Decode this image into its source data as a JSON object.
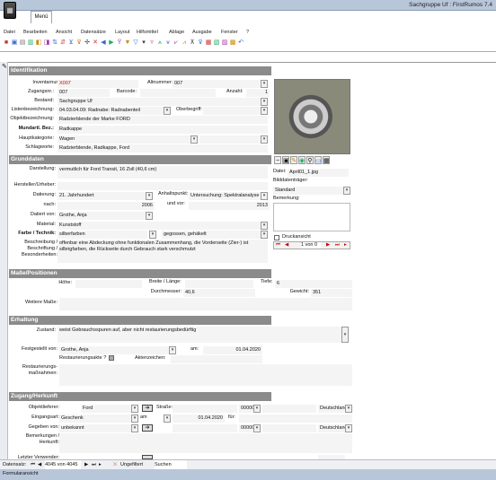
{
  "window": {
    "title": "Sachgruppe Uf : FirstRumos 7.4"
  },
  "menu_tab": "Menü",
  "menu": [
    "Datei",
    "Bearbeiten",
    "Ansicht",
    "Datensätze",
    "Layout",
    "Hilfsmittel",
    "Ablage",
    "Ausgabe",
    "Fenster",
    "?"
  ],
  "sections": {
    "identifikation": "Identifikation",
    "grunddaten": "Grunddaten",
    "masse": "Maße/Positionen",
    "erhaltung": "Erhaltung",
    "zugang": "Zugang/Herkunft"
  },
  "ident": {
    "inventarnummer_label": "Inventarnummer:",
    "inventarnummer": "X007",
    "altnummer_label": "Altnummer:",
    "altnummer": "007",
    "zugangsnr_label": "Zugangsnr.:",
    "zugangsnr": "007",
    "barcode_label": "Barcode:",
    "barcode": "",
    "anzahl_label": "Anzahl:",
    "anzahl": "1",
    "bestand_label": "Bestand:",
    "bestand": "Sachgruppe Uf",
    "listen_label": "Listenbezeichnung:",
    "listen": "04.03.04.09: Radnabe: Radnabenteil",
    "oberbegriff_label": "Oberbegriff:",
    "oberbegriff": "",
    "objekt_label": "Objektbezeichnung:",
    "objekt": "Radzierblende der Marke FORD",
    "mundart_label": "Mundartl. Bez.:",
    "mundart": "Radkappe",
    "haupt_label": "Hauptkategorie:",
    "haupt": "Wagen",
    "schlag_label": "Schlagworte:",
    "schlag": "Radzierblende, Radkappe, Ford"
  },
  "image_panel": {
    "datei_label": "Datei:",
    "datei": "April01_1.jpg",
    "bildtraeger_label": "Bilddatenträger:",
    "bildtraeger": "Standard",
    "bemerkung_label": "Bemerkung:",
    "bemerkung": "",
    "druck_label": "Druckansicht",
    "nav": "1 von 0"
  },
  "grund": {
    "darstellung_label": "Darstellung:",
    "darstellung": "vermutlich für Ford Transit, 16 Zoll (40,6 cm)",
    "hersteller_label": "Hersteller/Urheber:",
    "hersteller": "",
    "datierung_label": "Datierung:",
    "datierung": "21. Jahrhundert",
    "anhalt_label": "Anhaltspunkt:",
    "anhalt": "Untersuchung: Spektralanalyse",
    "nach_label": "nach:",
    "nach": "2006",
    "vor_label": "und vor:",
    "vor": "2013",
    "datiert_label": "Datiert von:",
    "datiert": "Grothe, Anja",
    "material_label": "Material:",
    "material": "Kunststoff",
    "farbe_label": "Farbe / Technik:",
    "farbe": "silberfarben",
    "technik": "gegossen, gehäkelt",
    "beschreibung_label": "Beschreibung / Beschriftung / Besonderheiten:",
    "beschreibung": "offenbar eine Abdeckung ohne funktionalen Zusammenhang, die Vorderseite (Zier-) ist silbrigfarben, die Rückseite durch Gebrauch stark verschmutzt"
  },
  "masse": {
    "hoehe_label": "Höhe:",
    "hoehe": "",
    "breite_label": "Breite / Länge:",
    "breite": "",
    "tiefe_label": "Tiefe:",
    "tiefe": "6",
    "durchmesser_label": "Durchmesser:",
    "durchmesser": "40,6",
    "gewicht_label": "Gewicht:",
    "gewicht": "351",
    "weitere_label": "Weitere Maße:",
    "weitere": ""
  },
  "erhaltung": {
    "zustand_label": "Zustand:",
    "zustand": "weist Gebrauchsspuren auf, aber nicht restaurierungsbedürftig",
    "festgestellt_label": "Festgestellt von:",
    "festgestellt": "Grothe, Anja",
    "am_label": "am:",
    "am": "01.04.2020",
    "akte_label": "Restaurierungsakte ?",
    "aktenzeichen_label": "Aktenzeichen:",
    "aktenzeichen": "",
    "massnahmen_label": "Restaurierungs-maßnahmen:",
    "massnahmen": ""
  },
  "zugang": {
    "objekt_label": "Objektlieferer:",
    "objekt": "Ford",
    "strasse_label": "Straße:",
    "strasse": "",
    "plz1": "00000",
    "land1": "Deutschland",
    "eingang_label": "Eingangsart:",
    "eingang": "Geschenk",
    "am_short": "am",
    "datum": "01.04.2020",
    "fuer": "für:",
    "fuer_val": "",
    "gegeben_label": "Gegeben von:",
    "gegeben": "unbekannt",
    "plz2": "00000",
    "land2": "Deutschland",
    "bemerk_label": "Bemerkungen / Herkunft:",
    "bemerk": "",
    "letzter_label": "Letzter Verwender:",
    "land3": "Deutschland"
  },
  "status": {
    "datensatz_label": "Datensatz:",
    "position": "4045 von 4045",
    "filter": "Ungefiltert",
    "search": "Suchen"
  },
  "bottom": "Formularansicht"
}
